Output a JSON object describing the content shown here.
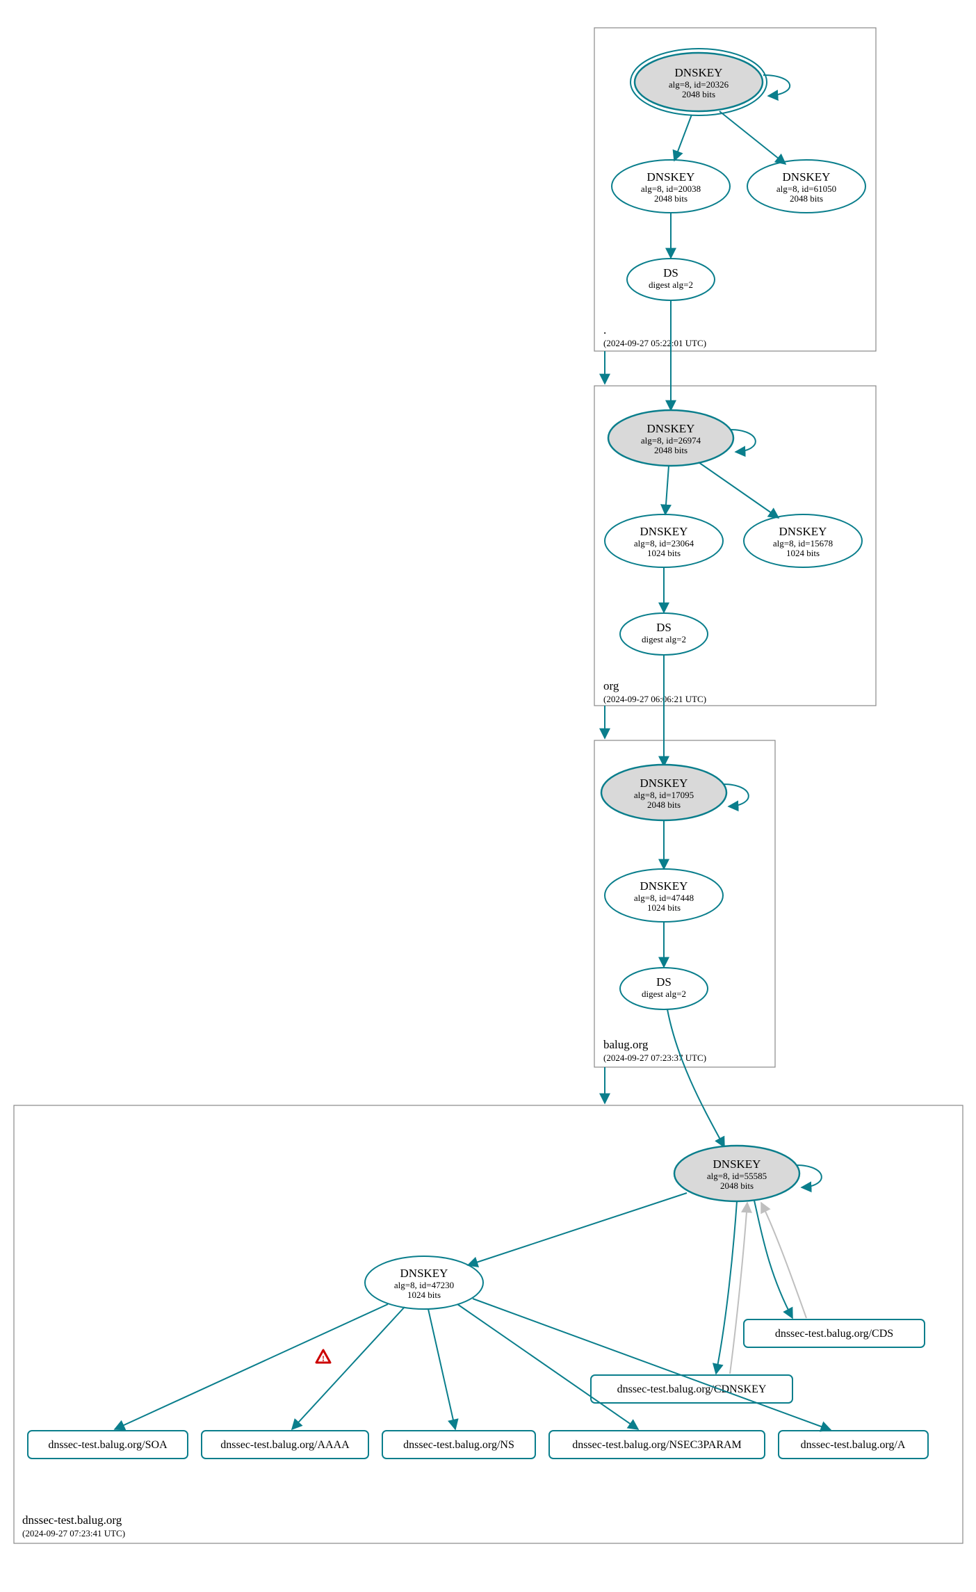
{
  "colors": {
    "stroke": "#0a7e8c",
    "ksk_fill": "#d9d9d9"
  },
  "zones": {
    "root": {
      "name": ".",
      "ts": "(2024-09-27 05:22:01 UTC)"
    },
    "org": {
      "name": "org",
      "ts": "(2024-09-27 06:06:21 UTC)"
    },
    "balug": {
      "name": "balug.org",
      "ts": "(2024-09-27 07:23:37 UTC)"
    },
    "leaf": {
      "name": "dnssec-test.balug.org",
      "ts": "(2024-09-27 07:23:41 UTC)"
    }
  },
  "nodes": {
    "root_ksk": {
      "t": "DNSKEY",
      "l2": "alg=8, id=20326",
      "l3": "2048 bits"
    },
    "root_zsk": {
      "t": "DNSKEY",
      "l2": "alg=8, id=20038",
      "l3": "2048 bits"
    },
    "root_zsk2": {
      "t": "DNSKEY",
      "l2": "alg=8, id=61050",
      "l3": "2048 bits"
    },
    "root_ds": {
      "t": "DS",
      "l2": "digest alg=2"
    },
    "org_ksk": {
      "t": "DNSKEY",
      "l2": "alg=8, id=26974",
      "l3": "2048 bits"
    },
    "org_zsk": {
      "t": "DNSKEY",
      "l2": "alg=8, id=23064",
      "l3": "1024 bits"
    },
    "org_zsk2": {
      "t": "DNSKEY",
      "l2": "alg=8, id=15678",
      "l3": "1024 bits"
    },
    "org_ds": {
      "t": "DS",
      "l2": "digest alg=2"
    },
    "balug_ksk": {
      "t": "DNSKEY",
      "l2": "alg=8, id=17095",
      "l3": "2048 bits"
    },
    "balug_zsk": {
      "t": "DNSKEY",
      "l2": "alg=8, id=47448",
      "l3": "1024 bits"
    },
    "balug_ds": {
      "t": "DS",
      "l2": "digest alg=2"
    },
    "leaf_ksk": {
      "t": "DNSKEY",
      "l2": "alg=8, id=55585",
      "l3": "2048 bits"
    },
    "leaf_zsk": {
      "t": "DNSKEY",
      "l2": "alg=8, id=47230",
      "l3": "1024 bits"
    }
  },
  "rrsets": {
    "soa": "dnssec-test.balug.org/SOA",
    "aaaa": "dnssec-test.balug.org/AAAA",
    "ns": "dnssec-test.balug.org/NS",
    "nsec3param": "dnssec-test.balug.org/NSEC3PARAM",
    "a": "dnssec-test.balug.org/A",
    "cdnskey": "dnssec-test.balug.org/CDNSKEY",
    "cds": "dnssec-test.balug.org/CDS"
  },
  "warn_icon": "⚠"
}
